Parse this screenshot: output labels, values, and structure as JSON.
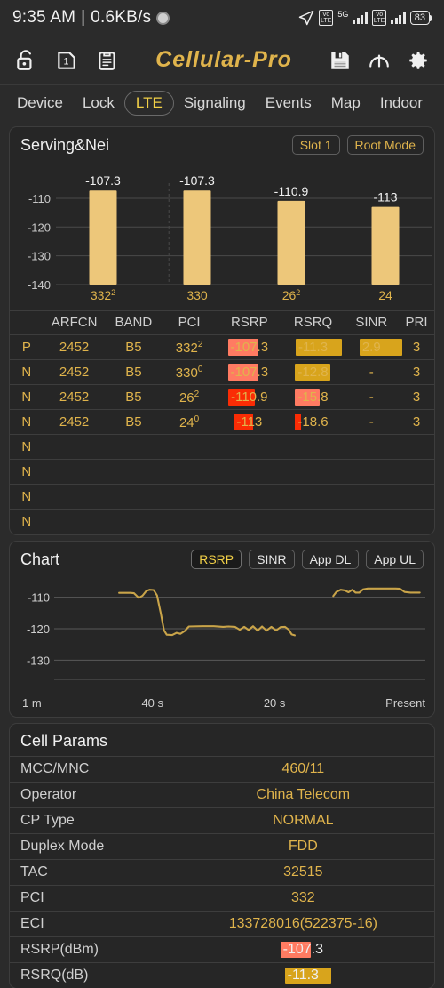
{
  "statusbar": {
    "time": "9:35 AM",
    "separator": "|",
    "netspeed": "0.6KB/s",
    "record_icon": "record-dot-icon",
    "location_icon": "location-arrow-icon",
    "volte1": "VoLTE",
    "nr_label": "5G",
    "volte2": "VoLTE",
    "battery": "83"
  },
  "toolbar": {
    "lock_icon": "unlock-icon",
    "sim_icon": "sim-card-1-icon",
    "clipboard_icon": "clipboard-icon",
    "brand": "Cellular-Pro",
    "save_icon": "save-floppy-icon",
    "gauge_icon": "speedometer-icon",
    "settings_icon": "gear-icon"
  },
  "tabs": [
    {
      "label": "Device",
      "active": false
    },
    {
      "label": "Lock",
      "active": false
    },
    {
      "label": "LTE",
      "active": true
    },
    {
      "label": "Signaling",
      "active": false
    },
    {
      "label": "Events",
      "active": false
    },
    {
      "label": "Map",
      "active": false
    },
    {
      "label": "Indoor",
      "active": false
    }
  ],
  "serving": {
    "title": "Serving&Nei",
    "chip_slot": "Slot 1",
    "chip_mode": "Root Mode",
    "columns": [
      "",
      "ARFCN",
      "BAND",
      "PCI",
      "RSRP",
      "RSRQ",
      "SINR",
      "PRI"
    ],
    "rows": [
      {
        "pn": "P",
        "arfcn": "2452",
        "band": "B5",
        "pci": "332",
        "pci_sup": "2",
        "rsrp": "-107.3",
        "rsrp_color": "#ff7b62",
        "rsrp_w": 34,
        "rsrq": "-11.3",
        "rsrq_color": "#d8a41c",
        "rsrq_w": 52,
        "sinr": "2.9",
        "sinr_color": "#d8a41c",
        "sinr_w": 48,
        "pri": "3"
      },
      {
        "pn": "N",
        "arfcn": "2452",
        "band": "B5",
        "pci": "330",
        "pci_sup": "0",
        "rsrp": "-107.3",
        "rsrp_color": "#ff7b62",
        "rsrp_w": 34,
        "rsrq": "-12.8",
        "rsrq_color": "#d8a41c",
        "rsrq_w": 40,
        "sinr": "-",
        "sinr_color": "",
        "sinr_w": 0,
        "pri": "3"
      },
      {
        "pn": "N",
        "arfcn": "2452",
        "band": "B5",
        "pci": "26",
        "pci_sup": "2",
        "rsrp": "-110.9",
        "rsrp_color": "#fa2c05",
        "rsrp_w": 30,
        "rsrq": "-15.8",
        "rsrq_color": "#ff7b62",
        "rsrq_w": 28,
        "sinr": "-",
        "sinr_color": "",
        "sinr_w": 0,
        "pri": "3"
      },
      {
        "pn": "N",
        "arfcn": "2452",
        "band": "B5",
        "pci": "24",
        "pci_sup": "0",
        "rsrp": "-113",
        "rsrp_color": "#fa2c05",
        "rsrp_w": 22,
        "rsrq": "-18.6",
        "rsrq_color": "#fa2c05",
        "rsrq_w": 7,
        "sinr": "-",
        "sinr_color": "",
        "sinr_w": 0,
        "pri": "3"
      },
      {
        "pn": "N",
        "arfcn": "",
        "band": "",
        "pci": "",
        "pci_sup": "",
        "rsrp": "",
        "rsrp_color": "",
        "rsrp_w": 0,
        "rsrq": "",
        "rsrq_color": "",
        "rsrq_w": 0,
        "sinr": "",
        "sinr_color": "",
        "sinr_w": 0,
        "pri": ""
      },
      {
        "pn": "N",
        "arfcn": "",
        "band": "",
        "pci": "",
        "pci_sup": "",
        "rsrp": "",
        "rsrp_color": "",
        "rsrp_w": 0,
        "rsrq": "",
        "rsrq_color": "",
        "rsrq_w": 0,
        "sinr": "",
        "sinr_color": "",
        "sinr_w": 0,
        "pri": ""
      },
      {
        "pn": "N",
        "arfcn": "",
        "band": "",
        "pci": "",
        "pci_sup": "",
        "rsrp": "",
        "rsrp_color": "",
        "rsrp_w": 0,
        "rsrq": "",
        "rsrq_color": "",
        "rsrq_w": 0,
        "sinr": "",
        "sinr_color": "",
        "sinr_w": 0,
        "pri": ""
      },
      {
        "pn": "N",
        "arfcn": "",
        "band": "",
        "pci": "",
        "pci_sup": "",
        "rsrp": "",
        "rsrp_color": "",
        "rsrp_w": 0,
        "rsrq": "",
        "rsrq_color": "",
        "rsrq_w": 0,
        "sinr": "",
        "sinr_color": "",
        "sinr_w": 0,
        "pri": ""
      }
    ]
  },
  "chart_card": {
    "title": "Chart",
    "buttons": [
      {
        "label": "RSRP",
        "active": true
      },
      {
        "label": "SINR",
        "active": false
      },
      {
        "label": "App DL",
        "active": false
      },
      {
        "label": "App UL",
        "active": false
      }
    ]
  },
  "cell_params": {
    "title": "Cell Params",
    "rows": [
      {
        "key": "MCC/MNC",
        "value": "460/11",
        "hl": "",
        "hl_w": 0
      },
      {
        "key": "Operator",
        "value": "China Telecom",
        "hl": "",
        "hl_w": 0
      },
      {
        "key": "CP Type",
        "value": "NORMAL",
        "hl": "",
        "hl_w": 0
      },
      {
        "key": "Duplex Mode",
        "value": "FDD",
        "hl": "",
        "hl_w": 0
      },
      {
        "key": "TAC",
        "value": "32515",
        "hl": "",
        "hl_w": 0
      },
      {
        "key": "PCI",
        "value": "332",
        "hl": "",
        "hl_w": 0
      },
      {
        "key": "ECI",
        "value": "133728016(522375-16)",
        "hl": "",
        "hl_w": 0
      },
      {
        "key": "RSRP(dBm)",
        "value": "-107.3",
        "hl": "#ff7b62",
        "hl_w": 34
      },
      {
        "key": "RSRQ(dB)",
        "value": "-11.3",
        "hl": "#d8a41c",
        "hl_w": 52
      }
    ]
  },
  "colors": {
    "brand": "#e0b44c",
    "accent_yellow": "#f2d047",
    "bar_fill": "#edc77a",
    "bg": "#2b2b2b",
    "card_bg": "#262626",
    "red": "#fa2c05",
    "salmon": "#ff7b62",
    "gold": "#d8a41c"
  },
  "chart_data": [
    {
      "type": "bar",
      "title": "Serving&Nei RSRP",
      "categories": [
        "332",
        "330",
        "26",
        "24"
      ],
      "category_sups": [
        "2",
        "",
        "2",
        ""
      ],
      "values": [
        -107.3,
        -107.3,
        -110.9,
        -113
      ],
      "labels": [
        "-107.3",
        "-107.3",
        "-110.9",
        "-113"
      ],
      "ylabel": "",
      "xlabel": "",
      "ylim": [
        -140,
        -106
      ],
      "yticks": [
        -110,
        -120,
        -130,
        -140
      ],
      "ytick_labels": [
        "-110",
        "-120",
        "-130",
        "-140"
      ],
      "grid": true,
      "legend": "none",
      "bar_color": "#edc77a"
    },
    {
      "type": "line",
      "title": "Chart",
      "series_name": "RSRP",
      "ylabel": "",
      "xlabel": "",
      "ylim": [
        -135,
        -105
      ],
      "yticks": [
        -110,
        -120,
        -130
      ],
      "ytick_labels": [
        "-110",
        "-120",
        "-130"
      ],
      "xtick_labels": [
        "1 m",
        "40 s",
        "20 s",
        "Present"
      ],
      "grid": true,
      "legend": "none",
      "line_color": "#c9a449",
      "segments": [
        {
          "points": [
            [
              0.175,
              -108.6
            ],
            [
              0.205,
              -108.6
            ],
            [
              0.215,
              -108.7
            ],
            [
              0.228,
              -110.2
            ],
            [
              0.238,
              -109.5
            ],
            [
              0.248,
              -108.0
            ],
            [
              0.257,
              -107.6
            ],
            [
              0.268,
              -107.7
            ],
            [
              0.277,
              -109.4
            ],
            [
              0.287,
              -115.0
            ],
            [
              0.296,
              -120.5
            ],
            [
              0.303,
              -121.9
            ],
            [
              0.318,
              -122.0
            ],
            [
              0.33,
              -121.3
            ],
            [
              0.34,
              -121.6
            ],
            [
              0.352,
              -120.7
            ],
            [
              0.363,
              -119.3
            ],
            [
              0.4,
              -119.2
            ],
            [
              0.43,
              -119.2
            ],
            [
              0.455,
              -119.4
            ],
            [
              0.47,
              -119.3
            ],
            [
              0.487,
              -119.4
            ],
            [
              0.5,
              -120.3
            ],
            [
              0.512,
              -119.4
            ],
            [
              0.524,
              -120.4
            ],
            [
              0.536,
              -119.2
            ],
            [
              0.548,
              -120.6
            ],
            [
              0.56,
              -119.3
            ],
            [
              0.572,
              -120.6
            ],
            [
              0.585,
              -119.4
            ],
            [
              0.598,
              -120.5
            ],
            [
              0.61,
              -119.5
            ],
            [
              0.622,
              -119.4
            ],
            [
              0.632,
              -120.3
            ],
            [
              0.64,
              -121.8
            ],
            [
              0.648,
              -122.1
            ]
          ]
        },
        {
          "points": [
            [
              0.752,
              -109.6
            ],
            [
              0.76,
              -108.3
            ],
            [
              0.772,
              -107.6
            ],
            [
              0.783,
              -107.8
            ],
            [
              0.793,
              -108.4
            ],
            [
              0.803,
              -107.6
            ],
            [
              0.812,
              -108.5
            ],
            [
              0.822,
              -108.5
            ],
            [
              0.832,
              -107.5
            ],
            [
              0.845,
              -107.2
            ],
            [
              0.88,
              -107.2
            ],
            [
              0.92,
              -107.2
            ],
            [
              0.932,
              -107.3
            ],
            [
              0.944,
              -108.3
            ],
            [
              0.96,
              -108.5
            ],
            [
              0.985,
              -108.5
            ]
          ]
        }
      ]
    }
  ]
}
